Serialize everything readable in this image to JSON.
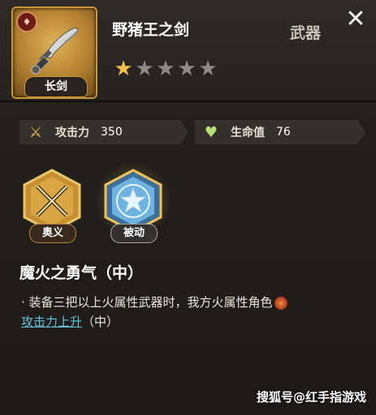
{
  "item": {
    "name": "野猪王之剑",
    "type": "武器",
    "weapon_class": "长剑",
    "element_icon": "fire-element-icon",
    "stars_total": 5,
    "stars_filled": 1
  },
  "close": {
    "label": "✕"
  },
  "stats": {
    "attack": {
      "label": "攻击力",
      "value": "350",
      "icon": "crossed-swords-icon"
    },
    "hp": {
      "label": "生命值",
      "value": "76",
      "icon": "heart-icon"
    }
  },
  "skills": [
    {
      "tag": "奥义",
      "icon": "crossed-swords-hex-icon"
    },
    {
      "tag": "被动",
      "icon": "star-hex-icon"
    }
  ],
  "description": {
    "title": "魔火之勇气（中）",
    "line1": "· 装备三把以上火属性武器时，我方火属性角色",
    "link": "攻击力上升",
    "suffix": "（中）"
  },
  "watermark": "搜狐号@红手指游戏",
  "colors": {
    "gold": "#c9963a",
    "star_gold": "#f2c14b",
    "link": "#66c3d9"
  }
}
